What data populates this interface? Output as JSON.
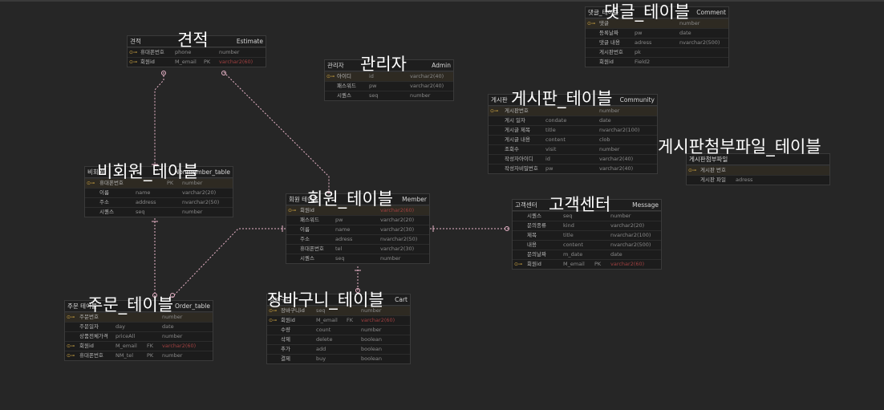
{
  "captions": [
    {
      "id": "estimate",
      "text": "견적"
    },
    {
      "id": "admin",
      "text": "관리자"
    },
    {
      "id": "comment",
      "text": "댓글_테이블"
    },
    {
      "id": "community",
      "text": "게시판_테이블"
    },
    {
      "id": "attach",
      "text": "게시판첨부파일_테이블"
    },
    {
      "id": "nonmember",
      "text": "비회원_테이블"
    },
    {
      "id": "member",
      "text": "회원_테이블"
    },
    {
      "id": "message",
      "text": "고객센터"
    },
    {
      "id": "order",
      "text": "주문_테이블"
    },
    {
      "id": "cart",
      "text": "장바구니_테이블"
    }
  ],
  "tables": [
    {
      "id": "estimate",
      "logical": "견적",
      "physical": "Estimate",
      "rows": [
        {
          "key": "⊙⊸",
          "l": "휴대폰번호",
          "p": "phone",
          "k": "",
          "t": "number",
          "red": false
        },
        {
          "key": "⊙⊸",
          "l": "회원id",
          "p": "M_email",
          "k": "PK",
          "t": "varchar2(60)",
          "red": true
        }
      ]
    },
    {
      "id": "admin",
      "logical": "관리자",
      "physical": "Admin",
      "rows": [
        {
          "key": "⊙⊸",
          "l": "아이디",
          "p": "id",
          "k": "",
          "t": "varchar2(40)",
          "red": false,
          "pk": true
        },
        {
          "key": "",
          "l": "패스워드",
          "p": "pw",
          "k": "",
          "t": "varchar2(40)",
          "red": false
        },
        {
          "key": "",
          "l": "시퀀스",
          "p": "seq",
          "k": "",
          "t": "number",
          "red": false
        }
      ]
    },
    {
      "id": "comment",
      "logical": "댓글_테이블",
      "physical": "Comment",
      "rows": [
        {
          "key": "⊙⊸",
          "l": "댓글",
          "p": "",
          "k": "",
          "t": "number",
          "red": false,
          "pk": true
        },
        {
          "key": "",
          "l": "등록날짜",
          "p": "pw",
          "k": "",
          "t": "date",
          "red": false
        },
        {
          "key": "",
          "l": "댓글 내용",
          "p": "adress",
          "k": "",
          "t": "nvarchar2(500)",
          "red": false
        },
        {
          "key": "",
          "l": "게시판번호",
          "p": "pk",
          "k": "",
          "t": "",
          "red": false
        },
        {
          "key": "",
          "l": "회원id",
          "p": "Field2",
          "k": "",
          "t": "",
          "red": false
        }
      ]
    },
    {
      "id": "community",
      "logical": "게시판",
      "physical": "Community",
      "rows": [
        {
          "key": "⊙⊸",
          "l": "게시판번호",
          "p": "",
          "k": "",
          "t": "number",
          "red": false,
          "pk": true
        },
        {
          "key": "",
          "l": "게시 일자",
          "p": "condate",
          "k": "",
          "t": "date",
          "red": false
        },
        {
          "key": "",
          "l": "게시글 제목",
          "p": "title",
          "k": "",
          "t": "nvarchar2(100)",
          "red": false
        },
        {
          "key": "",
          "l": "게시글 내용",
          "p": "content",
          "k": "",
          "t": "clob",
          "red": false
        },
        {
          "key": "",
          "l": "조회수",
          "p": "visit",
          "k": "",
          "t": "number",
          "red": false
        },
        {
          "key": "",
          "l": "작성자아이디",
          "p": "id",
          "k": "",
          "t": "varchar2(40)",
          "red": false
        },
        {
          "key": "",
          "l": "작성자비밀번호",
          "p": "pw",
          "k": "",
          "t": "varchar2(40)",
          "red": false
        }
      ]
    },
    {
      "id": "attach",
      "logical": "게시판첨부파일",
      "physical": "",
      "rows": [
        {
          "key": "⊙⊸",
          "l": "게시판 번호",
          "p": "",
          "k": "",
          "t": "",
          "red": false,
          "pk": true
        },
        {
          "key": "",
          "l": "게시판 파일",
          "p": "adress",
          "k": "",
          "t": "",
          "red": false
        }
      ]
    },
    {
      "id": "nonmember",
      "logical": "비회원",
      "physical": "Nonmember_table",
      "rows": [
        {
          "key": "⊙⊸",
          "l": "휴대폰번호",
          "p": "",
          "k": "PK",
          "t": "number",
          "red": false,
          "pk": true
        },
        {
          "key": "",
          "l": "이름",
          "p": "name",
          "k": "",
          "t": "varchar2(20)",
          "red": false
        },
        {
          "key": "",
          "l": "주소",
          "p": "address",
          "k": "",
          "t": "nvarchar2(50)",
          "red": false
        },
        {
          "key": "",
          "l": "시퀀스",
          "p": "seq",
          "k": "",
          "t": "number",
          "red": false
        }
      ]
    },
    {
      "id": "member",
      "logical": "회원 테이블",
      "physical": "Member",
      "rows": [
        {
          "key": "⊙⊸",
          "l": "회원id",
          "p": "",
          "k": "",
          "t": "varchar2(60)",
          "red": true,
          "pk": true
        },
        {
          "key": "",
          "l": "패스워드",
          "p": "pw",
          "k": "",
          "t": "varchar2(20)",
          "red": false
        },
        {
          "key": "",
          "l": "이름",
          "p": "name",
          "k": "",
          "t": "varchar2(30)",
          "red": false
        },
        {
          "key": "",
          "l": "주소",
          "p": "adress",
          "k": "",
          "t": "nvarchar2(50)",
          "red": false
        },
        {
          "key": "",
          "l": "휴대폰번호",
          "p": "tel",
          "k": "",
          "t": "varchar2(30)",
          "red": false
        },
        {
          "key": "",
          "l": "시퀀스",
          "p": "seq",
          "k": "",
          "t": "number",
          "red": false
        }
      ]
    },
    {
      "id": "message",
      "logical": "고객센터",
      "physical": "Message",
      "rows": [
        {
          "key": "",
          "l": "시퀀스",
          "p": "seq",
          "k": "",
          "t": "number",
          "red": false
        },
        {
          "key": "",
          "l": "문의종류",
          "p": "kind",
          "k": "",
          "t": "varchar2(20)",
          "red": false
        },
        {
          "key": "",
          "l": "제목",
          "p": "title",
          "k": "",
          "t": "nvarchar2(100)",
          "red": false
        },
        {
          "key": "",
          "l": "내용",
          "p": "content",
          "k": "",
          "t": "nvarchar2(500)",
          "red": false
        },
        {
          "key": "",
          "l": "문의날짜",
          "p": "m_date",
          "k": "",
          "t": "date",
          "red": false
        },
        {
          "key": "⊙⊸",
          "l": "회원id",
          "p": "M_email",
          "k": "PK",
          "t": "varchar2(60)",
          "red": true
        }
      ]
    },
    {
      "id": "order",
      "logical": "주문 테이블",
      "physical": "Order_table",
      "rows": [
        {
          "key": "⊙⊸",
          "l": "주문번호",
          "p": "",
          "k": "",
          "t": "number",
          "red": false,
          "pk": true
        },
        {
          "key": "",
          "l": "주문일자",
          "p": "day",
          "k": "",
          "t": "date",
          "red": false
        },
        {
          "key": "",
          "l": "상품전체가격",
          "p": "priceAll",
          "k": "",
          "t": "number",
          "red": false
        },
        {
          "key": "⊙⊸",
          "l": "회원id",
          "p": "M_email",
          "k": "FK",
          "t": "varchar2(60)",
          "red": true
        },
        {
          "key": "⊙⊸",
          "l": "휴대폰번호",
          "p": "NM_tel",
          "k": "PK",
          "t": "number",
          "red": false
        }
      ]
    },
    {
      "id": "cart",
      "logical": "장바구니",
      "physical": "Cart",
      "rows": [
        {
          "key": "⊙⊸",
          "l": "장바구니id",
          "p": "seq",
          "k": "",
          "t": "number",
          "red": false,
          "pk": true
        },
        {
          "key": "⊙⊸",
          "l": "회원id",
          "p": "M_email",
          "k": "FK",
          "t": "varchar2(60)",
          "red": true
        },
        {
          "key": "",
          "l": "수량",
          "p": "count",
          "k": "",
          "t": "number",
          "red": false
        },
        {
          "key": "",
          "l": "삭제",
          "p": "delete",
          "k": "",
          "t": "boolean",
          "red": false
        },
        {
          "key": "",
          "l": "추가",
          "p": "add",
          "k": "",
          "t": "boolean",
          "red": false
        },
        {
          "key": "",
          "l": "결제",
          "p": "buy",
          "k": "",
          "t": "boolean",
          "red": false
        }
      ]
    }
  ],
  "colors": {
    "line": "#e8b4c8",
    "background": "#262626",
    "table": "#1c1c1c",
    "fk_type": "#a04040"
  }
}
